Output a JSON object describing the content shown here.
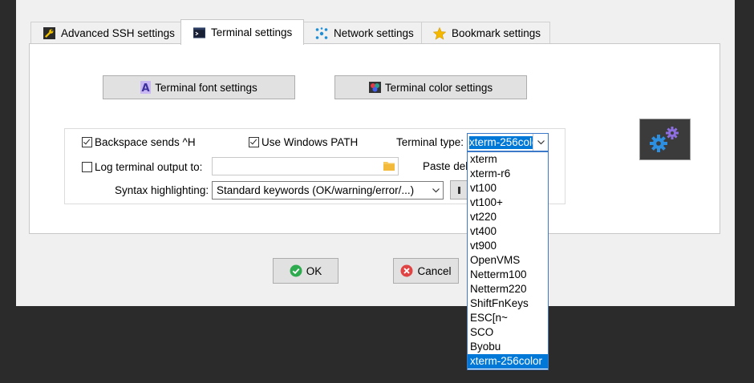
{
  "tabs": [
    {
      "label": "Advanced SSH settings",
      "icon": "wrench-icon",
      "active": false
    },
    {
      "label": "Terminal settings",
      "icon": "terminal-icon",
      "active": true
    },
    {
      "label": "Network settings",
      "icon": "network-icon",
      "active": false
    },
    {
      "label": "Bookmark settings",
      "icon": "star-icon",
      "active": false
    }
  ],
  "buttons": {
    "font": "Terminal font settings",
    "color": "Terminal color settings",
    "ok": "OK",
    "cancel": "Cancel"
  },
  "options": {
    "backspace": {
      "label": "Backspace sends ^H",
      "checked": true
    },
    "windows_path": {
      "label": "Use Windows PATH",
      "checked": true
    },
    "log_output": {
      "label": "Log terminal output to:",
      "checked": false
    },
    "terminal_type_label": "Terminal type:",
    "terminal_type_value": "xterm-256color",
    "log_path_value": "",
    "paste_label": "Paste del",
    "syntax_label": "Syntax highlighting:",
    "syntax_value": "Standard keywords (OK/warning/error/...)"
  },
  "dropdown": {
    "items": [
      "xterm",
      "xterm-r6",
      "vt100",
      "vt100+",
      "vt220",
      "vt400",
      "vt900",
      "OpenVMS",
      "Netterm100",
      "Netterm220",
      "ShiftFnKeys",
      "ESC[n~",
      "SCO",
      "Byobu",
      "xterm-256color"
    ],
    "selected": "xterm-256color"
  },
  "colors": {
    "accent": "#0078d7",
    "ok_green": "#2eaa4f",
    "cancel_red": "#e04343"
  }
}
